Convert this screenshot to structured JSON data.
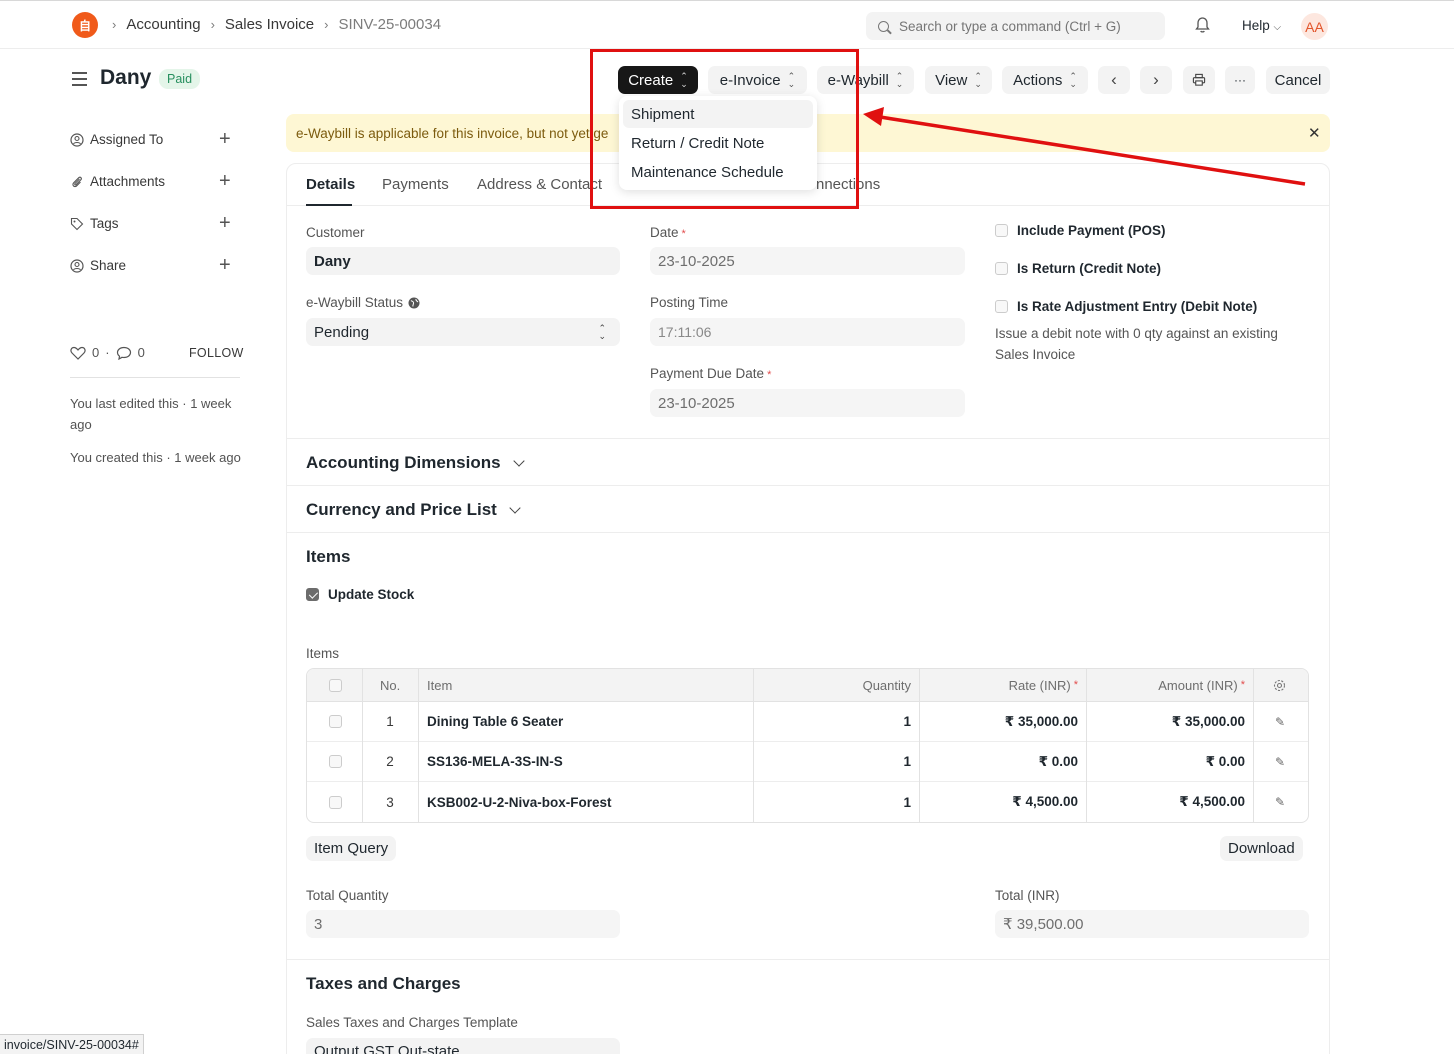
{
  "navbar": {
    "logo_text": "自",
    "breadcrumbs": [
      "Accounting",
      "Sales Invoice",
      "SINV-25-00034"
    ],
    "search_placeholder": "Search or type a command (Ctrl + G)",
    "help_label": "Help",
    "avatar_initials": "AA"
  },
  "header": {
    "title": "Dany",
    "status": "Paid",
    "buttons": {
      "create": "Create",
      "e_invoice": "e-Invoice",
      "e_waybill": "e-Waybill",
      "view": "View",
      "actions": "Actions",
      "more": "···",
      "cancel": "Cancel"
    }
  },
  "create_menu": {
    "items": [
      "Shipment",
      "Return / Credit Note",
      "Maintenance Schedule"
    ]
  },
  "sidebar": {
    "items": [
      "Assigned To",
      "Attachments",
      "Tags",
      "Share"
    ],
    "likes": "0",
    "comments": "0",
    "follow": "FOLLOW",
    "edited_note": "You last edited this · 1 week ago",
    "created_note": "You created this · 1 week ago"
  },
  "banner": {
    "text": "e-Waybill is applicable for this invoice, but not yet ge"
  },
  "tabs": [
    "Details",
    "Payments",
    "Address & Contact",
    "nnections"
  ],
  "details": {
    "customer_label": "Customer",
    "customer_value": "Dany",
    "ewaybill_status_label": "e-Waybill Status",
    "ewaybill_status_value": "Pending",
    "date_label": "Date",
    "date_value": "23-10-2025",
    "posting_time_label": "Posting Time",
    "posting_time_value": "17:11:06",
    "due_date_label": "Payment Due Date",
    "due_date_value": "23-10-2025",
    "checks": [
      "Include Payment (POS)",
      "Is Return (Credit Note)",
      "Is Rate Adjustment Entry (Debit Note)"
    ],
    "debit_note_help": "Issue a debit note with 0 qty against an existing Sales Invoice"
  },
  "sections": {
    "accounting_dimensions": "Accounting Dimensions",
    "currency_price_list": "Currency and Price List",
    "items": "Items",
    "taxes": "Taxes and Charges"
  },
  "items": {
    "update_stock_label": "Update Stock",
    "table_label": "Items",
    "columns": [
      "No.",
      "Item",
      "Quantity",
      "Rate (INR)",
      "Amount (INR)"
    ],
    "rows": [
      {
        "no": "1",
        "item": "Dining Table 6 Seater",
        "qty": "1",
        "rate": "₹ 35,000.00",
        "amount": "₹ 35,000.00"
      },
      {
        "no": "2",
        "item": "SS136-MELA-3S-IN-S",
        "qty": "1",
        "rate": "₹ 0.00",
        "amount": "₹ 0.00"
      },
      {
        "no": "3",
        "item": "KSB002-U-2-Niva-box-Forest",
        "qty": "1",
        "rate": "₹ 4,500.00",
        "amount": "₹ 4,500.00"
      }
    ],
    "item_query_button": "Item Query",
    "download_button": "Download",
    "total_qty_label": "Total Quantity",
    "total_qty_value": "3",
    "total_label": "Total (INR)",
    "total_value": "₹ 39,500.00"
  },
  "taxes": {
    "template_label": "Sales Taxes and Charges Template",
    "template_value": "Output GST Out-state"
  },
  "statusbar": {
    "url": "invoice/SINV-25-00034#"
  },
  "colors": {
    "annotation": "#e01010",
    "logo": "#f05a1a",
    "paid_badge": "#278f5e"
  }
}
